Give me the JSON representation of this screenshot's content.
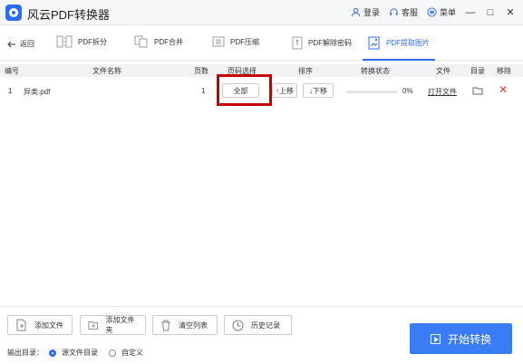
{
  "app": {
    "title": "风云PDF转换器"
  },
  "header": {
    "login": "登录",
    "service": "客服",
    "menu": "菜单",
    "minimize": "—",
    "maximize": "□",
    "close": "✕"
  },
  "toolbar": {
    "back": "返回",
    "tools": [
      {
        "label": "PDF拆分",
        "icon": "split-icon"
      },
      {
        "label": "PDF合并",
        "icon": "merge-icon"
      },
      {
        "label": "PDF压缩",
        "icon": "compress-icon"
      },
      {
        "label": "PDF解除密码",
        "icon": "unlock-icon"
      },
      {
        "label": "PDF提取图片",
        "icon": "image-extract-icon"
      }
    ],
    "active": "PDF提取图片"
  },
  "table": {
    "headers": [
      "编号",
      "文件名称",
      "页数",
      "页码选择",
      "排序",
      "转换状态",
      "文件",
      "目录",
      "移除"
    ],
    "rows": [
      {
        "index": "1",
        "filename": "异类.pdf",
        "pages": "1",
        "page_select": "全部",
        "up": "↑上移",
        "down": "↓下移",
        "progress_percent": 0,
        "status": "0%",
        "file_action": "打开文件"
      }
    ]
  },
  "footer": {
    "add_file": "添加文件",
    "add_folder": "添加文件夹",
    "clear_list": "清空列表",
    "history": "历史记录",
    "output_dir_label": "输出目录：",
    "output_options": [
      "源文件目录",
      "自定义"
    ],
    "selected_output": "源文件目录",
    "start": "开始转换"
  },
  "colors": {
    "accent": "#2f6cf5",
    "highlight": "#c40000",
    "delete": "#ee3333"
  }
}
